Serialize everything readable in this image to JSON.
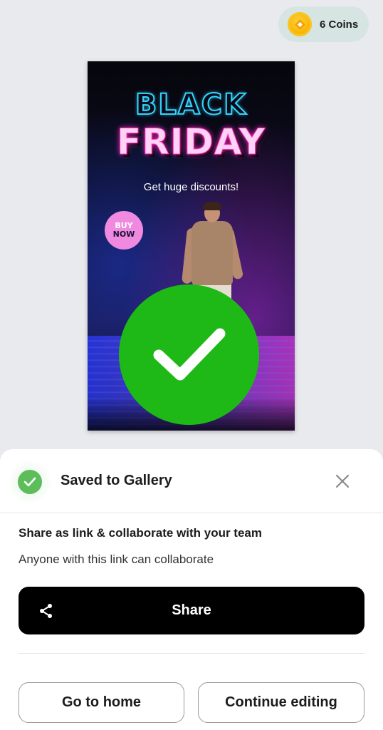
{
  "coins": {
    "label": "6 Coins",
    "icon": "coin-icon"
  },
  "poster": {
    "headline_1": "BLACK",
    "headline_2": "FRIDAY",
    "subtitle": "Get huge discounts!",
    "badge_line_1": "BUY",
    "badge_line_2": "NOW",
    "success_icon": "checkmark-icon",
    "success_color": "#1eb917"
  },
  "sheet": {
    "saved_title": "Saved to Gallery",
    "share_heading": "Share as link & collaborate with your team",
    "share_sub": "Anyone with this link can collaborate",
    "share_button": "Share",
    "home_button": "Go to home",
    "continue_button": "Continue editing"
  },
  "colors": {
    "saved_green": "#5cbd5a",
    "primary_button": "#000000"
  }
}
